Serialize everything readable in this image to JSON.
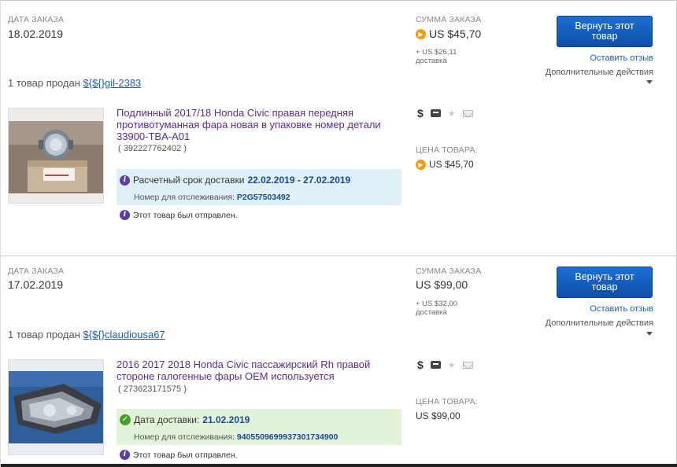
{
  "orders": [
    {
      "order_date_label": "ДАТА ЗАКАЗА",
      "order_date": "18.02.2019",
      "order_total_label": "СУММА ЗАКАЗА",
      "order_total": "US $45,70",
      "shipping_cost": "+ US $26,11",
      "shipping_label": "доставка",
      "return_button": "Вернуть этот товар",
      "feedback_link": "Оставить отзыв",
      "more_actions": "Дополнительные действия",
      "sold_prefix": "1 товар продан",
      "seller": "${${}gil-2383",
      "item_title": "Подлинный 2017/18 Honda Civic правая передняя противотуманная фара новая в упаковке номер детали 33900-TBA-A01",
      "item_number": "( 392227762402 )",
      "delivery_label": "Расчетный срок доставки",
      "delivery_value": "22.02.2019 - 27.02.2019",
      "tracking_label": "Номер для отслеживания:",
      "tracking_number": "P2G57503492",
      "shipped_note": "Этот товар был отправлен.",
      "item_price_label": "ЦЕНА ТОВАРА:",
      "item_price": "US $45,70",
      "status_color": "#dff0f7"
    },
    {
      "order_date_label": "ДАТА ЗАКАЗА",
      "order_date": "17.02.2019",
      "order_total_label": "СУММА ЗАКАЗА",
      "order_total": "US $99,00",
      "shipping_cost": "+ US $32,00",
      "shipping_label": "доставка",
      "return_button": "Вернуть этот товар",
      "feedback_link": "Оставить отзыв",
      "more_actions": "Дополнительные действия",
      "sold_prefix": "1 товар продан",
      "seller": "${${}claudiousa67",
      "item_title": "2016 2017 2018 Honda Civic пассажирский Rh правой стороне галогенные фары OEM используется",
      "item_number": "( 273623171575 )",
      "delivery_label": "Дата доставки:",
      "delivery_value": "21.02.2019",
      "tracking_label": "Номер для отслеживания:",
      "tracking_number": "9405509699937301734900",
      "shipped_note": "Этот товар был отправлен.",
      "item_price_label": "ЦЕНА ТОВАРА:",
      "item_price": "US $99,00",
      "status_color": "#e3f3d9"
    }
  ],
  "icons": [
    "dollar-icon",
    "box-icon",
    "star-icon",
    "envelope-icon",
    "info-icon",
    "checkmark-icon",
    "coin-icon"
  ],
  "colors": {
    "button": "#0e4fa8",
    "link": "#1a5fb4",
    "title": "#5b2c8f",
    "tracking": "#1a4a8c"
  }
}
